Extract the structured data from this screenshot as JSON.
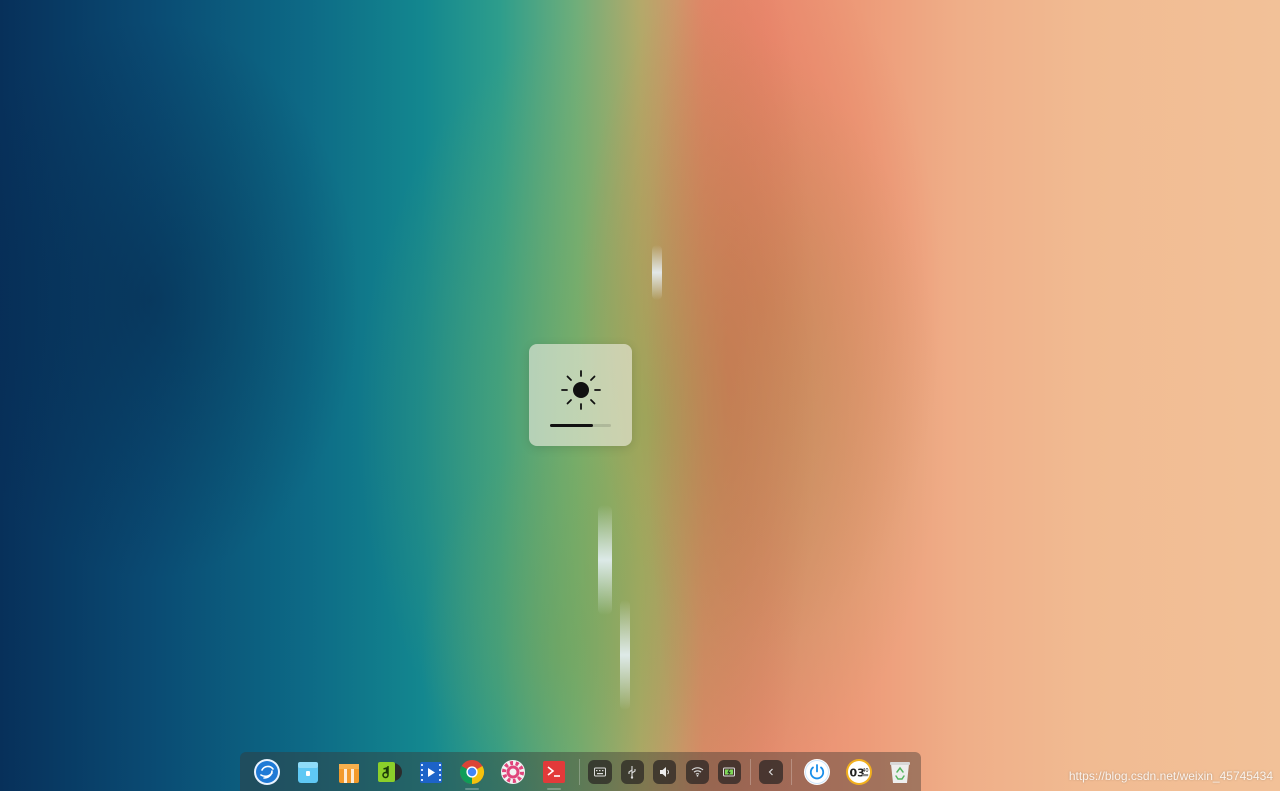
{
  "desktop": {
    "wallpaper": "aerial-beach"
  },
  "osd": {
    "type": "brightness",
    "icon": "sun-icon",
    "level": 0.7
  },
  "dock": {
    "apps": [
      {
        "name": "launcher",
        "icon": "deepin-launcher-icon"
      },
      {
        "name": "file-manager",
        "icon": "file-manager-icon"
      },
      {
        "name": "app-store",
        "icon": "app-store-icon"
      },
      {
        "name": "music",
        "icon": "music-icon"
      },
      {
        "name": "movie",
        "icon": "movie-icon"
      },
      {
        "name": "chrome",
        "icon": "chrome-icon"
      },
      {
        "name": "settings",
        "icon": "settings-icon"
      },
      {
        "name": "terminal",
        "icon": "terminal-icon"
      }
    ],
    "tray": [
      {
        "name": "keyboard",
        "icon": "keyboard-icon"
      },
      {
        "name": "usb",
        "icon": "usb-icon"
      },
      {
        "name": "volume",
        "icon": "volume-icon"
      },
      {
        "name": "wifi",
        "icon": "wifi-icon"
      },
      {
        "name": "battery",
        "icon": "battery-icon"
      },
      {
        "name": "expand",
        "icon": "chevron-left-icon"
      }
    ],
    "right": [
      {
        "name": "power",
        "icon": "power-icon"
      },
      {
        "name": "clock",
        "icon": "clock-icon",
        "hour": "03",
        "minute": "40"
      },
      {
        "name": "trash",
        "icon": "trash-icon"
      }
    ]
  },
  "watermark": "https://blog.csdn.net/weixin_45745434"
}
